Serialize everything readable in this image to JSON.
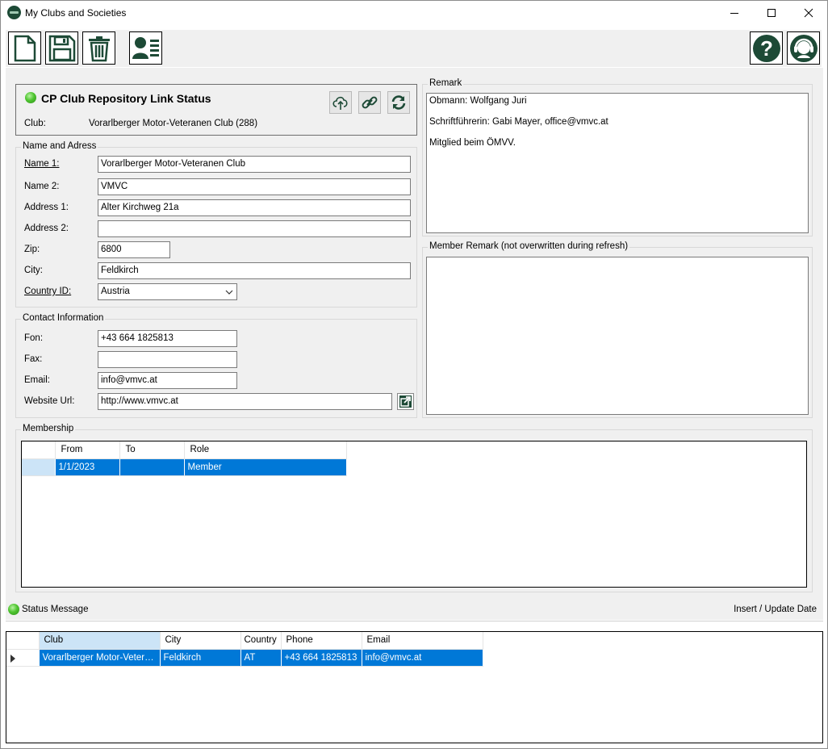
{
  "window": {
    "title": "My Clubs and Societies"
  },
  "toolbar": {
    "left_icons": [
      "new-document-icon",
      "save-icon",
      "delete-icon",
      "contact-card-icon"
    ],
    "right_icons": [
      "help-icon",
      "support-headset-icon"
    ]
  },
  "link_status": {
    "title": "CP Club Repository Link Status",
    "club_label": "Club:",
    "club_value": "Vorarlberger Motor-Veteranen Club (288)",
    "status_color": "#4fc530"
  },
  "name_address": {
    "group_title": "Name and Adress",
    "name1_label": "Name 1:",
    "name1_value": "Vorarlberger Motor-Veteranen Club",
    "name2_label": "Name 2:",
    "name2_value": "VMVC",
    "address1_label": "Address 1:",
    "address1_value": "Alter Kirchweg 21a",
    "address2_label": "Address 2:",
    "address2_value": "",
    "zip_label": "Zip:",
    "zip_value": "6800",
    "city_label": "City:",
    "city_value": "Feldkirch",
    "country_label": "Country ID:",
    "country_value": "Austria"
  },
  "contact": {
    "group_title": "Contact Information",
    "fon_label": "Fon:",
    "fon_value": "+43 664 1825813",
    "fax_label": "Fax:",
    "fax_value": "",
    "email_label": "Email:",
    "email_value": "info@vmvc.at",
    "website_label": "Website Url:",
    "website_value": "http://www.vmvc.at"
  },
  "remark": {
    "group_title": "Remark",
    "lines": [
      "Obmann: Wolfgang Juri",
      "Schriftführerin: Gabi Mayer, office@vmvc.at",
      "Mitglied beim ÖMVV."
    ]
  },
  "member_remark": {
    "group_title": "Member Remark (not overwritten during refresh)",
    "text": ""
  },
  "membership": {
    "group_title": "Membership",
    "columns": [
      "From",
      "To",
      "Role"
    ],
    "rows": [
      {
        "from": "1/1/2023",
        "to": "",
        "role": "Member"
      }
    ]
  },
  "statusbar": {
    "message": "Status Message",
    "right_text": "Insert / Update Date"
  },
  "clubs_grid": {
    "columns": [
      "Club",
      "City",
      "Country",
      "Phone",
      "Email"
    ],
    "rows": [
      {
        "club": "Vorarlberger Motor-Veteranen Club",
        "city": "Feldkirch",
        "country": "AT",
        "phone": "+43 664 1825813",
        "email": "info@vmvc.at"
      }
    ]
  },
  "colors": {
    "accent_green": "#1d4a36",
    "selection_blue": "#0078d7"
  }
}
